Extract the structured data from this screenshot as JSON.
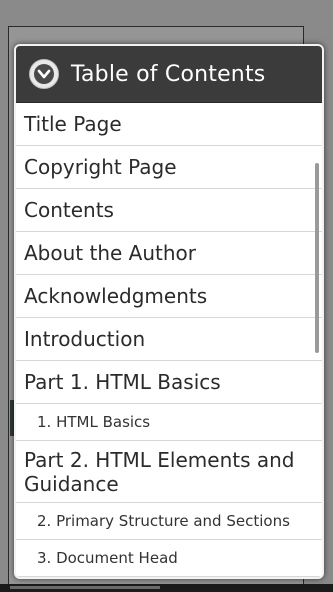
{
  "dialog": {
    "title": "Table of Contents",
    "icon": "chevron-down-circle-icon",
    "items": [
      {
        "label": "Title Page",
        "level": 1
      },
      {
        "label": "Copyright Page",
        "level": 1
      },
      {
        "label": "Contents",
        "level": 1
      },
      {
        "label": "About the Author",
        "level": 1
      },
      {
        "label": "Acknowledgments",
        "level": 1
      },
      {
        "label": "Introduction",
        "level": 1
      },
      {
        "label": "Part 1. HTML Basics",
        "level": 1
      },
      {
        "label": "1. HTML Basics",
        "level": 2
      },
      {
        "label": "Part 2. HTML Elements and Guidance",
        "level": 1
      },
      {
        "label": "2. Primary Structure and Sections",
        "level": 2
      },
      {
        "label": "3. Document Head",
        "level": 2
      }
    ]
  },
  "colors": {
    "header_bg": "#3b3b3b",
    "list_bg": "#ffffff",
    "divider": "#d7d7d7"
  }
}
